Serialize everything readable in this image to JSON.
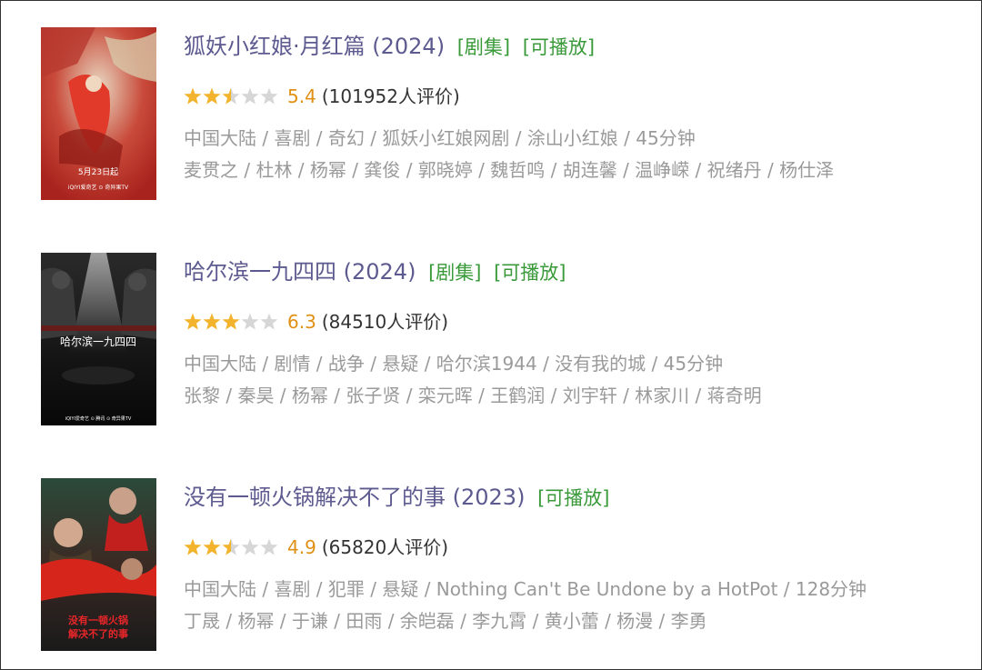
{
  "colors": {
    "title": "#5c5a8f",
    "tag": "#3a9a3a",
    "score": "#e09015",
    "star_on": "#f3b32c",
    "star_off": "#d6d6d6",
    "meta": "#9a9a9a"
  },
  "items": [
    {
      "title": "狐妖小红娘·月红篇 (2024)",
      "tags": [
        "[剧集]",
        "[可播放]"
      ],
      "rating": 5.4,
      "score_text": "5.4",
      "votes_text": "(101952人评价)",
      "genres": "中国大陆 / 喜剧 / 奇幻 / 狐妖小红娘网剧 / 涂山小红娘 / 45分钟",
      "cast": "麦贯之 / 杜林 / 杨幂 / 龚俊 / 郭晓婷 / 魏哲鸣 / 胡连馨 / 温峥嵘 / 祝绪丹 / 杨仕泽",
      "poster": {
        "icon": "poster-image",
        "texts": [
          "5月23日起",
          "iQIYI爱奇艺  ⊙ 奇异果TV"
        ]
      }
    },
    {
      "title": "哈尔滨一九四四 (2024)",
      "tags": [
        "[剧集]",
        "[可播放]"
      ],
      "rating": 6.3,
      "score_text": "6.3",
      "votes_text": "(84510人评价)",
      "genres": "中国大陆 / 剧情 / 战争 / 悬疑 / 哈尔滨1944 / 没有我的城 / 45分钟",
      "cast": "张黎 / 秦昊 / 杨幂 / 张子贤 / 栾元晖 / 王鹤润 / 刘宇轩 / 林家川 / 蒋奇明",
      "poster": {
        "icon": "poster-image",
        "texts": [
          "哈尔滨一九四四",
          "iQIYI爱奇艺  ⊙ 腾讯  ⊙ 奇异果TV"
        ]
      }
    },
    {
      "title": "没有一顿火锅解决不了的事 (2023)",
      "tags": [
        "[可播放]"
      ],
      "rating": 4.9,
      "score_text": "4.9",
      "votes_text": "(65820人评价)",
      "genres": "中国大陆 / 喜剧 / 犯罪 / 悬疑 / Nothing Can't Be Undone by a HotPot / 128分钟",
      "cast": "丁晟 / 杨幂 / 于谦 / 田雨 / 余皑磊 / 李九霄 / 黄小蕾 / 杨漫 / 李勇",
      "poster": {
        "icon": "poster-image",
        "texts": [
          "没有一顿火锅",
          "解决不了的事"
        ]
      }
    }
  ]
}
